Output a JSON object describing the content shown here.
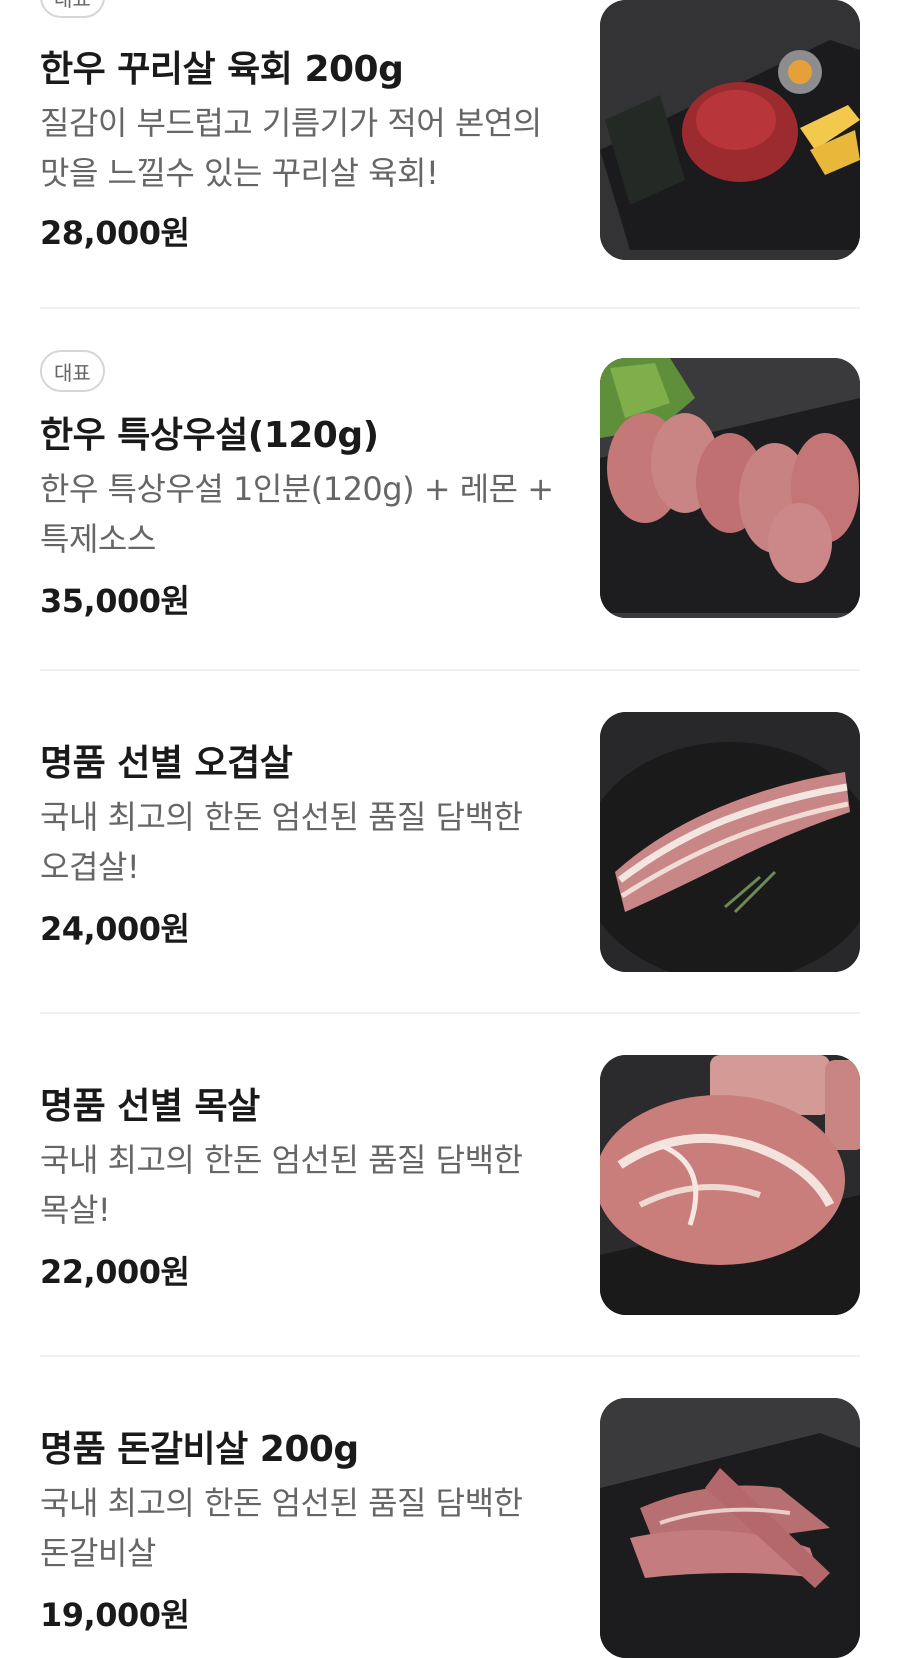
{
  "menu": {
    "items": [
      {
        "badge": "대표",
        "name": "한우 꾸리살 육회 200g",
        "desc": "질감이 부드럽고 기름기가 적어 본연의 맛을 느낄수 있는 꾸리살 육회!",
        "price": "28,000원",
        "image_icon": "beef-tartare-image"
      },
      {
        "badge": "대표",
        "name": "한우 특상우설(120g)",
        "desc": "한우 특상우설 1인분(120g) + 레몬 + 특제소스",
        "price": "35,000원",
        "image_icon": "beef-tongue-image"
      },
      {
        "name": "명품 선별 오겹살",
        "desc": "국내 최고의 한돈 엄선된 품질 담백한 오겹살!",
        "price": "24,000원",
        "image_icon": "pork-belly-image"
      },
      {
        "name": "명품 선별 목살",
        "desc": "국내 최고의 한돈 엄선된 품질 담백한 목살!",
        "price": "22,000원",
        "image_icon": "pork-neck-image"
      },
      {
        "name": "명품 돈갈비살 200g",
        "desc": "국내 최고의 한돈 엄선된 품질 담백한 돈갈비살",
        "price": "19,000원",
        "image_icon": "pork-rib-image"
      }
    ]
  },
  "colors": {
    "text_primary": "#1a1a1a",
    "text_secondary": "#666666",
    "badge_border": "#d6d6d6",
    "divider": "#f0f0f0",
    "image_bg": "#2f2f31"
  }
}
